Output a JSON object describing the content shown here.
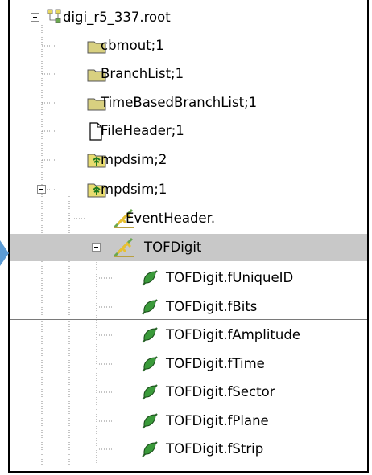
{
  "tree": {
    "root": {
      "label": "digi_r5_337.root",
      "icon": "root-file-icon"
    },
    "items": [
      {
        "label": "cbmout;1",
        "icon": "folder-icon"
      },
      {
        "label": "BranchList;1",
        "icon": "folder-icon"
      },
      {
        "label": "TimeBasedBranchList;1",
        "icon": "folder-icon"
      },
      {
        "label": "FileHeader;1",
        "icon": "document-icon"
      },
      {
        "label": "mpdsim;2",
        "icon": "tree-folder-icon"
      },
      {
        "label": "mpdsim;1",
        "icon": "tree-folder-icon"
      },
      {
        "label": "EventHeader.",
        "icon": "branch-icon"
      },
      {
        "label": "TOFDigit",
        "icon": "branch-icon"
      },
      {
        "label": "TOFDigit.fUniqueID",
        "icon": "leaf-icon"
      },
      {
        "label": "TOFDigit.fBits",
        "icon": "leaf-icon"
      },
      {
        "label": "TOFDigit.fAmplitude",
        "icon": "leaf-icon"
      },
      {
        "label": "TOFDigit.fTime",
        "icon": "leaf-icon"
      },
      {
        "label": "TOFDigit.fSector",
        "icon": "leaf-icon"
      },
      {
        "label": "TOFDigit.fPlane",
        "icon": "leaf-icon"
      },
      {
        "label": "TOFDigit.fStrip",
        "icon": "leaf-icon"
      }
    ]
  },
  "colors": {
    "selection": "#c8c8c8",
    "pointer_arrow": "#5b9bd5",
    "folder": "#d8d080"
  }
}
